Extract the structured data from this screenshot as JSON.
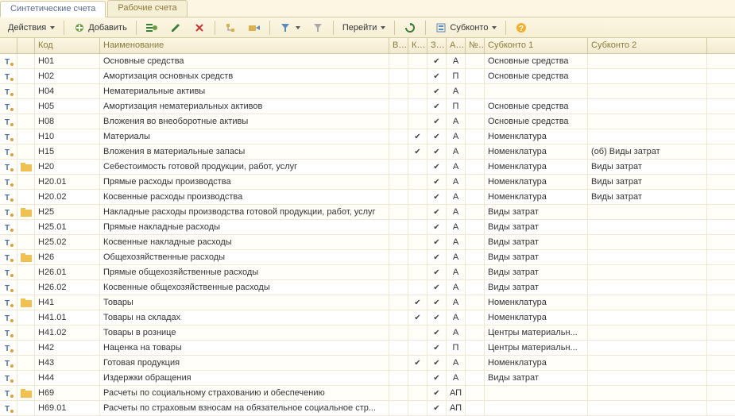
{
  "tabs": {
    "active": "Синтетические счета",
    "other": "Рабочие счета"
  },
  "toolbar": {
    "actions": "Действия",
    "add": "Добавить",
    "goto": "Перейти",
    "subconto": "Субконто"
  },
  "columns": {
    "code": "Код",
    "name": "Наименование",
    "v": "В...",
    "k": "К...",
    "z": "З...",
    "a": "А...",
    "n": "№..",
    "s1": "Субконто 1",
    "s2": "Субконто 2"
  },
  "rows": [
    {
      "folder": false,
      "code": "Н01",
      "name": "Основные средства",
      "k": false,
      "z": true,
      "a": "А",
      "s1": "Основные средства",
      "s2": ""
    },
    {
      "folder": false,
      "code": "Н02",
      "name": "Амортизация основных средств",
      "k": false,
      "z": true,
      "a": "П",
      "s1": "Основные средства",
      "s2": ""
    },
    {
      "folder": false,
      "code": "Н04",
      "name": "Нематериальные активы",
      "k": false,
      "z": true,
      "a": "А",
      "s1": "",
      "s2": ""
    },
    {
      "folder": false,
      "code": "Н05",
      "name": "Амортизация нематериальных активов",
      "k": false,
      "z": true,
      "a": "П",
      "s1": "Основные средства",
      "s2": ""
    },
    {
      "folder": false,
      "code": "Н08",
      "name": "Вложения во внеоборотные активы",
      "k": false,
      "z": true,
      "a": "А",
      "s1": "Основные средства",
      "s2": ""
    },
    {
      "folder": false,
      "code": "Н10",
      "name": "Материалы",
      "k": true,
      "z": true,
      "a": "А",
      "s1": "Номенклатура",
      "s2": ""
    },
    {
      "folder": false,
      "code": "Н15",
      "name": "Вложения в материальные запасы",
      "k": true,
      "z": true,
      "a": "А",
      "s1": "Номенклатура",
      "s2": "(об) Виды затрат"
    },
    {
      "folder": true,
      "code": "Н20",
      "name": "Себестоимость готовой продукции, работ, услуг",
      "k": false,
      "z": true,
      "a": "А",
      "s1": "Номенклатура",
      "s2": "Виды затрат"
    },
    {
      "folder": false,
      "code": "Н20.01",
      "name": "Прямые расходы производства",
      "k": false,
      "z": true,
      "a": "А",
      "s1": "Номенклатура",
      "s2": "Виды затрат"
    },
    {
      "folder": false,
      "code": "Н20.02",
      "name": "Косвенные расходы производства",
      "k": false,
      "z": true,
      "a": "А",
      "s1": "Номенклатура",
      "s2": "Виды затрат"
    },
    {
      "folder": true,
      "code": "Н25",
      "name": "Накладные расходы производства готовой продукции, работ, услуг",
      "k": false,
      "z": true,
      "a": "А",
      "s1": "Виды затрат",
      "s2": ""
    },
    {
      "folder": false,
      "code": "Н25.01",
      "name": "Прямые накладные расходы",
      "k": false,
      "z": true,
      "a": "А",
      "s1": "Виды затрат",
      "s2": ""
    },
    {
      "folder": false,
      "code": "Н25.02",
      "name": "Косвенные накладные расходы",
      "k": false,
      "z": true,
      "a": "А",
      "s1": "Виды затрат",
      "s2": ""
    },
    {
      "folder": true,
      "code": "Н26",
      "name": "Общехозяйственные расходы",
      "k": false,
      "z": true,
      "a": "А",
      "s1": "Виды затрат",
      "s2": ""
    },
    {
      "folder": false,
      "code": "Н26.01",
      "name": "Прямые общехозяйственные расходы",
      "k": false,
      "z": true,
      "a": "А",
      "s1": "Виды затрат",
      "s2": ""
    },
    {
      "folder": false,
      "code": "Н26.02",
      "name": "Косвенные общехозяйственные расходы",
      "k": false,
      "z": true,
      "a": "А",
      "s1": "Виды затрат",
      "s2": ""
    },
    {
      "folder": true,
      "code": "Н41",
      "name": "Товары",
      "k": true,
      "z": true,
      "a": "А",
      "s1": "Номенклатура",
      "s2": ""
    },
    {
      "folder": false,
      "code": "Н41.01",
      "name": "Товары на складах",
      "k": true,
      "z": true,
      "a": "А",
      "s1": "Номенклатура",
      "s2": ""
    },
    {
      "folder": false,
      "code": "Н41.02",
      "name": "Товары в рознице",
      "k": false,
      "z": true,
      "a": "А",
      "s1": "Центры материальн...",
      "s2": ""
    },
    {
      "folder": false,
      "code": "Н42",
      "name": "Наценка на товары",
      "k": false,
      "z": true,
      "a": "П",
      "s1": "Центры материальн...",
      "s2": ""
    },
    {
      "folder": false,
      "code": "Н43",
      "name": "Готовая продукция",
      "k": true,
      "z": true,
      "a": "А",
      "s1": "Номенклатура",
      "s2": ""
    },
    {
      "folder": false,
      "code": "Н44",
      "name": "Издержки обращения",
      "k": false,
      "z": true,
      "a": "А",
      "s1": "Виды затрат",
      "s2": ""
    },
    {
      "folder": true,
      "code": "Н69",
      "name": "Расчеты по социальному страхованию и обеспечению",
      "k": false,
      "z": true,
      "a": "АП",
      "s1": "",
      "s2": ""
    },
    {
      "folder": false,
      "code": "Н69.01",
      "name": "Расчеты по страховым взносам на обязательное социальное стр...",
      "k": false,
      "z": true,
      "a": "АП",
      "s1": "",
      "s2": ""
    }
  ]
}
